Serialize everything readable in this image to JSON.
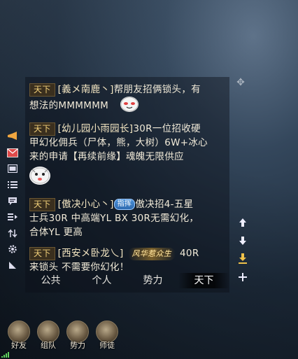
{
  "chat": {
    "messages": [
      {
        "channel": "天下",
        "sender": "[義メ南鹿丶]",
        "text_line1": "帮朋友招俩锁头，有",
        "text_line2": "想法的MMMMMM"
      },
      {
        "channel": "天下",
        "sender": "[幼儿园小雨园长]",
        "text_line1": "30R一位招收硬",
        "text_line2": "甲幻化佣兵（尸体，熊，大树）6W+冰心",
        "text_line3": "来的申请【再续前缘】魂魄无限供应"
      },
      {
        "channel": "天下",
        "sender": "[傲决小心丶]",
        "badge": "指挥",
        "text_line1": "傲决招4-五星",
        "text_line2": "士兵30R  中高端YL BX  30R无需幻化，",
        "text_line3": "合体YL 更高"
      },
      {
        "channel": "天下",
        "sender": "[西安メ卧龙乀]",
        "title_badge": "风华惹众生",
        "text_line1": "40R",
        "text_line2": "来锁头 不需要你幻化！"
      }
    ],
    "tabs": [
      {
        "label": "公共"
      },
      {
        "label": "个人"
      },
      {
        "label": "势力"
      },
      {
        "label": "天下",
        "active": true
      }
    ]
  },
  "left_toolbar": [
    {
      "icon": "megaphone-icon"
    },
    {
      "icon": "mail-icon"
    },
    {
      "icon": "window-icon"
    },
    {
      "icon": "list-icon"
    },
    {
      "icon": "speech-bubble-icon"
    },
    {
      "icon": "filter-icon"
    },
    {
      "icon": "exchange-icon"
    },
    {
      "icon": "gear-icon"
    },
    {
      "icon": "corner-resize-icon"
    }
  ],
  "right_toolbar": [
    {
      "icon": "arrow-up-icon"
    },
    {
      "icon": "arrow-down-icon"
    },
    {
      "icon": "scroll-to-bottom-icon"
    },
    {
      "icon": "plus-icon"
    }
  ],
  "bottom_bar": [
    {
      "label": "好友",
      "icon": "friends-icon"
    },
    {
      "label": "组队",
      "icon": "team-flag-icon"
    },
    {
      "label": "势力",
      "icon": "faction-scroll-icon"
    },
    {
      "label": "师徒",
      "icon": "mentor-icon"
    }
  ]
}
